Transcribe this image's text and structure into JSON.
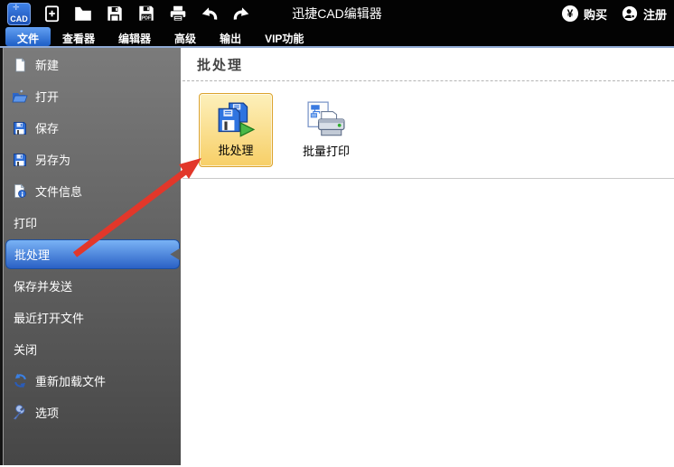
{
  "window": {
    "title": "迅捷CAD编辑器"
  },
  "topbar": {
    "logo_text": "CAD",
    "logo_crosshair": "✛",
    "currency_symbol": "¥",
    "buy_label": "购买",
    "register_label": "注册",
    "icons": [
      "new-icon",
      "open-folder-icon",
      "save-icon",
      "export-pdf-icon",
      "print-icon",
      "undo-icon",
      "redo-icon"
    ],
    "pdf_badge": "PDF"
  },
  "menubar": {
    "tabs": [
      {
        "label": "文件",
        "active": true
      },
      {
        "label": "查看器",
        "active": false
      },
      {
        "label": "编辑器",
        "active": false
      },
      {
        "label": "高级",
        "active": false
      },
      {
        "label": "输出",
        "active": false
      },
      {
        "label": "VIP功能",
        "active": false
      }
    ]
  },
  "sidebar": {
    "items": [
      {
        "label": "新建",
        "icon": "new-file-icon"
      },
      {
        "label": "打开",
        "icon": "open-folder-icon"
      },
      {
        "label": "保存",
        "icon": "save-icon"
      },
      {
        "label": "另存为",
        "icon": "save-as-icon"
      },
      {
        "label": "文件信息",
        "icon": "file-info-icon"
      },
      {
        "label": "打印",
        "icon": ""
      },
      {
        "label": "批处理",
        "icon": "",
        "selected": true
      },
      {
        "label": "保存并发送",
        "icon": ""
      },
      {
        "label": "最近打开文件",
        "icon": ""
      },
      {
        "label": "关闭",
        "icon": ""
      },
      {
        "label": "重新加载文件",
        "icon": "reload-icon"
      },
      {
        "label": "选项",
        "icon": "options-icon"
      }
    ]
  },
  "main": {
    "section_title": "批处理",
    "items": [
      {
        "label": "批处理",
        "icon": "batch-process-icon",
        "selected": true
      },
      {
        "label": "批量打印",
        "icon": "batch-print-icon",
        "selected": false
      }
    ]
  },
  "annotation": {
    "type": "red-arrow",
    "color": "#e2372a"
  },
  "colors": {
    "selection_blue": "#2a61c5",
    "highlight_orange_bg": "#f7cf67",
    "highlight_orange_border": "#dca32d",
    "titlebar_bg": "#030303",
    "sidebar_top": "#7b7b7b",
    "sidebar_bottom": "#464646"
  }
}
